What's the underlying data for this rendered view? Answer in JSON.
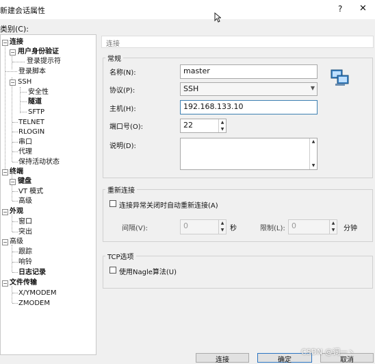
{
  "window": {
    "title": "新建会话属性",
    "help": "?",
    "close": "✕"
  },
  "category_label": "类别(C):",
  "tree": [
    {
      "id": "connect",
      "label": "连接",
      "bold": true
    },
    {
      "id": "user-auth",
      "label": "用户身份验证",
      "bold": true
    },
    {
      "id": "login-prompt",
      "label": "登录提示符",
      "bold": false
    },
    {
      "id": "login-script",
      "label": "登录脚本",
      "bold": false
    },
    {
      "id": "ssh",
      "label": "SSH",
      "bold": false
    },
    {
      "id": "security",
      "label": "安全性",
      "bold": false
    },
    {
      "id": "tunnel",
      "label": "隧道",
      "bold": true
    },
    {
      "id": "sftp",
      "label": "SFTP",
      "bold": false
    },
    {
      "id": "telnet",
      "label": "TELNET",
      "bold": false
    },
    {
      "id": "rlogin",
      "label": "RLOGIN",
      "bold": false
    },
    {
      "id": "serial",
      "label": "串口",
      "bold": false
    },
    {
      "id": "proxy",
      "label": "代理",
      "bold": false
    },
    {
      "id": "keepalive",
      "label": "保持活动状态",
      "bold": false
    },
    {
      "id": "terminal",
      "label": "终端",
      "bold": true
    },
    {
      "id": "keyboard",
      "label": "键盘",
      "bold": true
    },
    {
      "id": "vt-mode",
      "label": "VT 模式",
      "bold": false
    },
    {
      "id": "advanced1",
      "label": "高级",
      "bold": false
    },
    {
      "id": "appearance",
      "label": "外观",
      "bold": true
    },
    {
      "id": "window",
      "label": "窗口",
      "bold": false
    },
    {
      "id": "highlight",
      "label": "突出",
      "bold": false
    },
    {
      "id": "advanced2",
      "label": "高级",
      "bold": false
    },
    {
      "id": "trace",
      "label": "跟踪",
      "bold": false
    },
    {
      "id": "bell",
      "label": "响铃",
      "bold": false
    },
    {
      "id": "log",
      "label": "日志记录",
      "bold": true
    },
    {
      "id": "file-transfer",
      "label": "文件传输",
      "bold": true
    },
    {
      "id": "xymodem",
      "label": "X/YMODEM",
      "bold": false
    },
    {
      "id": "zmodem",
      "label": "ZMODEM",
      "bold": false
    }
  ],
  "panel": {
    "header": "连接",
    "general": {
      "title": "常规",
      "name_label": "名称(N):",
      "name_value": "master",
      "protocol_label": "协议(P):",
      "protocol_value": "SSH",
      "host_label": "主机(H):",
      "host_value": "192.168.133.10",
      "port_label": "端口号(O):",
      "port_value": "22",
      "desc_label": "说明(D):",
      "desc_value": ""
    },
    "reconnect": {
      "title": "重新连接",
      "auto_label": "连接异常关闭时自动重新连接(A)",
      "interval_label": "间隔(V):",
      "interval_value": "0",
      "interval_unit": "秒",
      "limit_label": "限制(L):",
      "limit_value": "0",
      "limit_unit": "分钟"
    },
    "tcp": {
      "title": "TCP选项",
      "nagle_label": "使用Nagle算法(U)"
    }
  },
  "buttons": {
    "connect": "连接",
    "ok": "确定",
    "cancel": "取消"
  },
  "watermark": "CSDN @词一丶"
}
